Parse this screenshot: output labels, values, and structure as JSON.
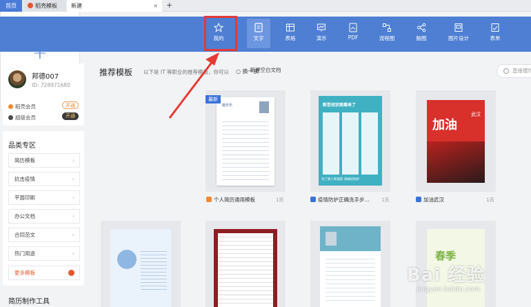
{
  "tabs": {
    "home": "首页",
    "templates": "稻壳模板",
    "new_tab": "新建",
    "close": "×",
    "add": "+"
  },
  "toolbar": {
    "items": [
      {
        "label": "我的",
        "icon": "star-icon"
      },
      {
        "label": "文字",
        "icon": "document-icon"
      },
      {
        "label": "表格",
        "icon": "table-icon"
      },
      {
        "label": "演示",
        "icon": "slides-icon"
      },
      {
        "label": "PDF",
        "icon": "pdf-icon"
      },
      {
        "label": "流程图",
        "icon": "flowchart-icon"
      },
      {
        "label": "脑图",
        "icon": "mindmap-icon"
      },
      {
        "label": "图片设计",
        "icon": "image-design-icon"
      },
      {
        "label": "表单",
        "icon": "form-icon"
      }
    ],
    "active": "文字",
    "colors": {
      "bar": "#4e7fd3",
      "highlight": "#e53a33"
    }
  },
  "profile": {
    "name": "邦德007",
    "id": "ID: 728971680",
    "member1": "稻壳会员",
    "member2": "超级会员",
    "open_label": "开通"
  },
  "categories": {
    "title": "品类专区",
    "items": [
      "简历模板",
      "抗击疫情",
      "平面印刷",
      "办公文档",
      "合同范文",
      "热门用途"
    ],
    "more": "更多模板",
    "chevron": "›"
  },
  "tools": {
    "title": "简历制作工具"
  },
  "main": {
    "heading": "推荐模板",
    "subtitle": "以下是 IT 等职业的推荐模板，你可以",
    "switch_label": "换一换",
    "search_placeholder": "直接搜你",
    "new_blank": "新建空白文档",
    "new_badge": "最新"
  },
  "templates": [
    {
      "title": "个人简历通用模板",
      "pages": "1页"
    },
    {
      "title": "疫情防护正确洗手步...",
      "pages": "1页"
    },
    {
      "title": "加油武汉",
      "pages": "1页"
    }
  ],
  "thumb_texts": {
    "resume_name": "姚乐乐",
    "handwash_title": "新型冠状病毒来了",
    "handwash_footer": "为了家人和朋友  请做好防护",
    "wuhan_text": "加油",
    "wuhan_sub": "武汉",
    "spring": "春季"
  },
  "watermark": {
    "main": "Bai 经验",
    "sub": "jingyan.baidu.com"
  }
}
